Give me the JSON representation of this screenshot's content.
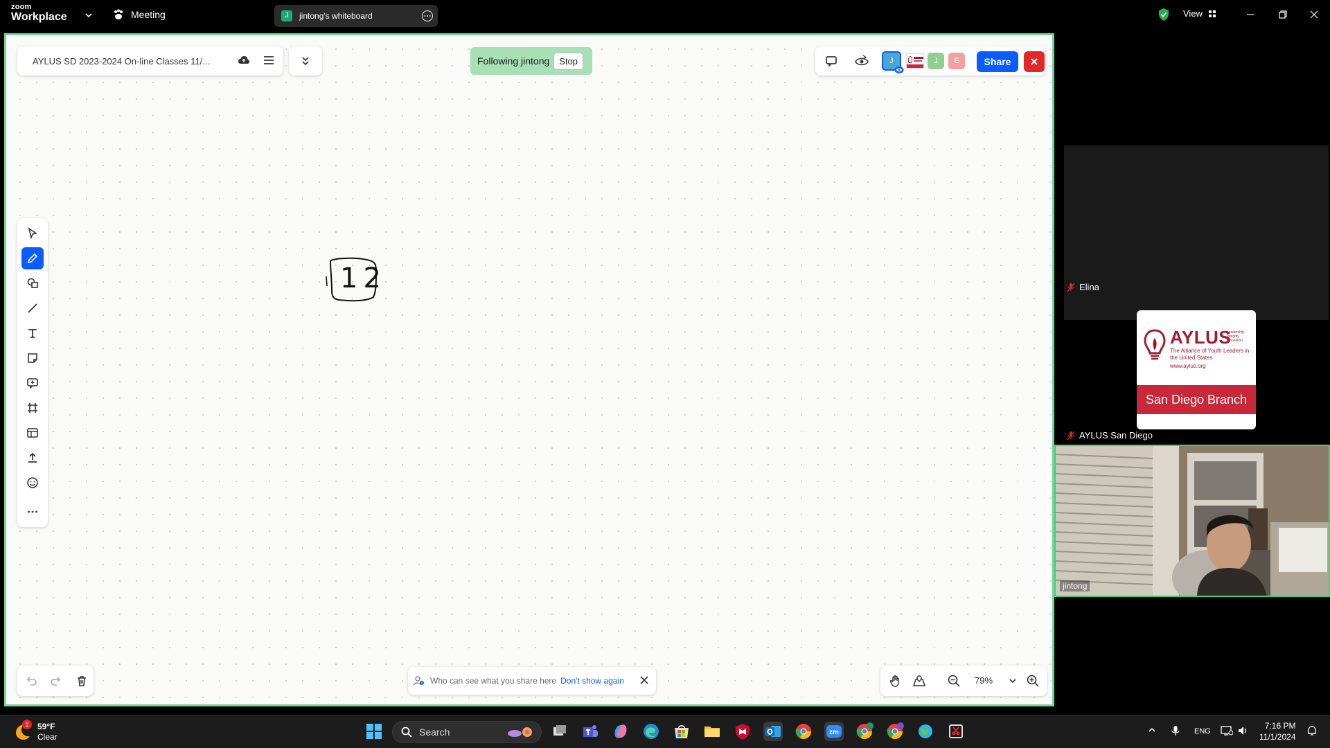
{
  "titlebar": {
    "logo_top": "zoom",
    "logo_bottom": "Workplace",
    "meeting_label": "Meeting",
    "tab_avatar": "J",
    "tab_title": "jintong's whiteboard",
    "view_label": "View"
  },
  "whiteboard": {
    "doc_title": "AYLUS SD 2023-2024 On-line Classes 11/...",
    "following_label": "Following jintong",
    "stop_label": "Stop",
    "avatars": [
      {
        "letter": "J",
        "color": "#49a7d6"
      },
      {
        "letter": "J",
        "color": "#8fcf8f"
      },
      {
        "letter": "E",
        "color": "#f3a0a0"
      }
    ],
    "share_label": "Share",
    "info_text": "Who can see what you share here",
    "dont_show_label": "Don't show again",
    "zoom_level": "79%",
    "drawing_text": "12"
  },
  "participants": {
    "top_name": "Elina",
    "mid_name": "AYLUS San Diego",
    "video_name": "jintong",
    "logo": {
      "brand": "AYLUS",
      "tagline": "Leadership Integrity Innovation",
      "subtitle": "The Alliance of Youth Leaders in the United States",
      "url": "www.aylus.org",
      "branch": "San Diego Branch"
    }
  },
  "taskbar": {
    "weather_temp": "59°F",
    "weather_cond": "Clear",
    "weather_badge": "1",
    "search_placeholder": "Search",
    "language": "ENG",
    "time": "7:16 PM",
    "date": "11/1/2024"
  },
  "colors": {
    "accent": "#0b5cff",
    "whiteboard_border": "#73d39a",
    "close": "#e02828",
    "aylus_red": "#c8283a"
  }
}
